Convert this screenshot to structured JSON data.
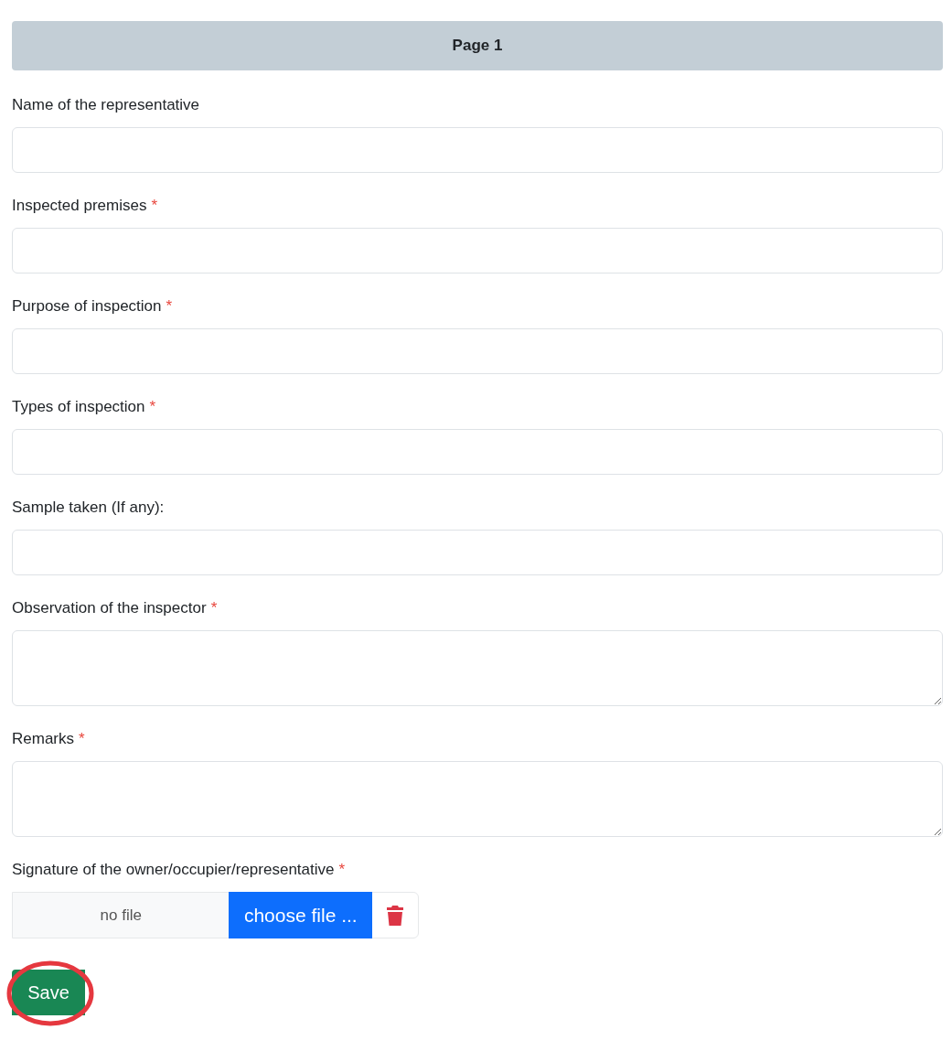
{
  "header": {
    "title": "Page 1"
  },
  "fields": [
    {
      "kind": "input",
      "label": "Name of the representative",
      "required": false
    },
    {
      "kind": "input",
      "label": "Inspected premises",
      "required": true,
      "mark": "*"
    },
    {
      "kind": "input",
      "label": "Purpose of inspection",
      "required": true,
      "mark": "*"
    },
    {
      "kind": "input",
      "label": "Types of inspection",
      "required": true,
      "mark": "*"
    },
    {
      "kind": "input",
      "label": "Sample taken (If any):",
      "required": false
    },
    {
      "kind": "textarea",
      "label": "Observation of the inspector",
      "required": true,
      "mark": "*"
    },
    {
      "kind": "textarea",
      "label": "Remarks",
      "required": true,
      "mark": "*"
    },
    {
      "kind": "file",
      "label": "Signature of the owner/occupier/representative",
      "required": true,
      "mark": "*",
      "file_name": "no file",
      "button": "choose file ..."
    }
  ],
  "save_button": {
    "label": "Save",
    "highlighted": true
  }
}
